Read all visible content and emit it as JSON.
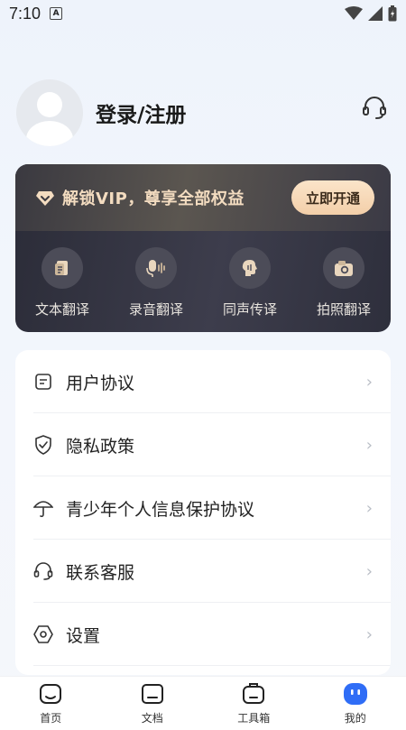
{
  "status_bar": {
    "time": "7:10",
    "a_badge": "A"
  },
  "profile": {
    "login_label": "登录/注册",
    "support_icon": "headset-icon"
  },
  "vip": {
    "title": "解锁VIP，尊享全部权益",
    "button_label": "立即开通",
    "accent_color": "#f3dcc0",
    "features": [
      {
        "label": "文本翻译",
        "icon": "document-translate-icon"
      },
      {
        "label": "录音翻译",
        "icon": "microphone-icon"
      },
      {
        "label": "同声传译",
        "icon": "speaking-head-icon"
      },
      {
        "label": "拍照翻译",
        "icon": "camera-icon"
      }
    ]
  },
  "menu": [
    {
      "label": "用户协议",
      "icon": "agreement-icon"
    },
    {
      "label": "隐私政策",
      "icon": "shield-check-icon"
    },
    {
      "label": "青少年个人信息保护协议",
      "icon": "umbrella-icon"
    },
    {
      "label": "联系客服",
      "icon": "headset-icon"
    },
    {
      "label": "设置",
      "icon": "settings-hex-icon"
    }
  ],
  "bottom_nav": [
    {
      "label": "首页",
      "icon": "home-icon",
      "active": false
    },
    {
      "label": "文档",
      "icon": "document-icon",
      "active": false
    },
    {
      "label": "工具箱",
      "icon": "toolbox-icon",
      "active": false
    },
    {
      "label": "我的",
      "icon": "profile-face-icon",
      "active": true
    }
  ],
  "colors": {
    "active_blue": "#2f6df6",
    "card_dark": "#2b2c38"
  }
}
